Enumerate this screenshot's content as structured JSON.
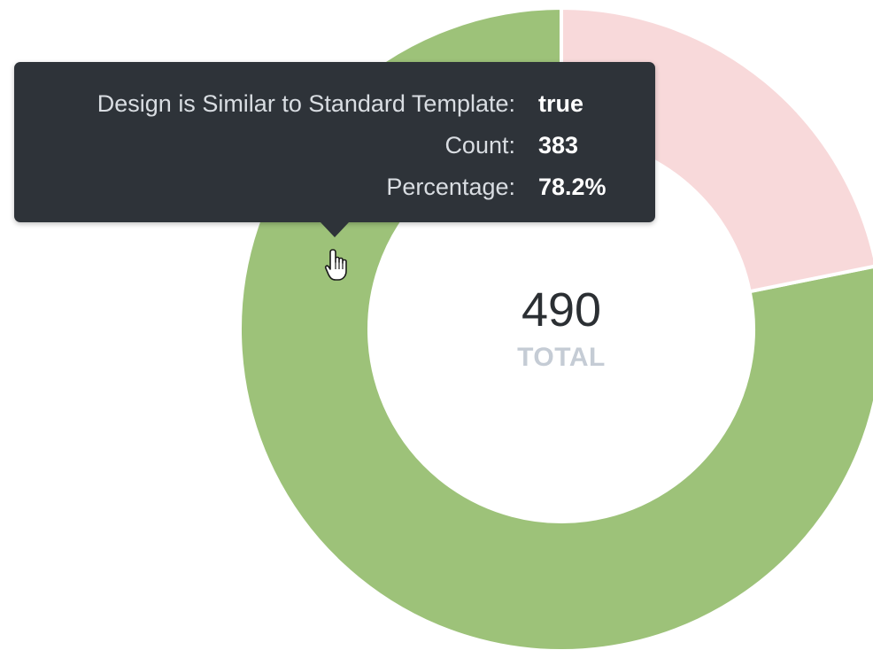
{
  "chart_data": {
    "type": "pie",
    "variant": "donut",
    "categories": [
      "true",
      "false"
    ],
    "values": [
      383,
      107
    ],
    "colors": [
      "#9dc279",
      "#f8d9da"
    ],
    "total": 490,
    "total_label": "TOTAL",
    "legend": "none"
  },
  "tooltip": {
    "rows": [
      {
        "key": "Design is Similar to Standard Template:",
        "value": "true"
      },
      {
        "key": "Count:",
        "value": "383"
      },
      {
        "key": "Percentage:",
        "value": "78.2%"
      }
    ]
  },
  "center": {
    "total": "490",
    "label": "TOTAL"
  },
  "cursor": {
    "icon": "hand-pointer-icon"
  }
}
